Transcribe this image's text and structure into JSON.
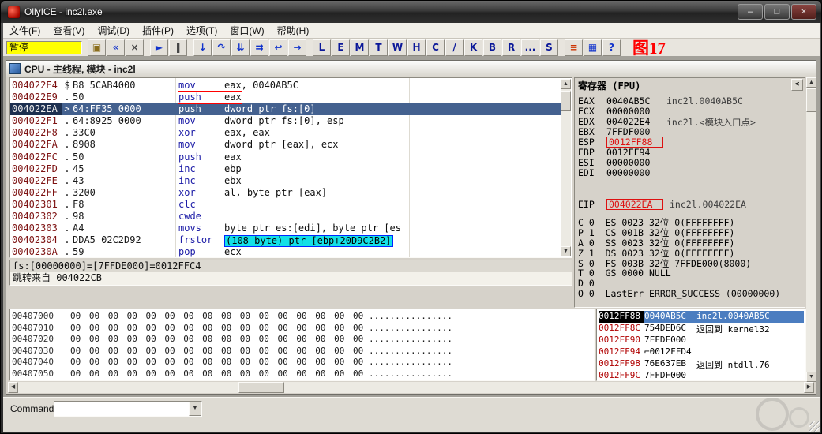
{
  "window": {
    "title": "OllyICE - inc2l.exe",
    "controls": [
      {
        "name": "minimize-button",
        "glyph": "–"
      },
      {
        "name": "maximize-button",
        "glyph": "□"
      },
      {
        "name": "close-button",
        "glyph": "×"
      }
    ]
  },
  "menu": {
    "items": [
      {
        "key": "file",
        "label": "文件(F)"
      },
      {
        "key": "view",
        "label": "查看(V)"
      },
      {
        "key": "debug",
        "label": "调试(D)"
      },
      {
        "key": "plugins",
        "label": "插件(P)"
      },
      {
        "key": "options",
        "label": "选项(T)"
      },
      {
        "key": "window",
        "label": "窗口(W)"
      },
      {
        "key": "help",
        "label": "帮助(H)"
      }
    ]
  },
  "toolbar": {
    "status": "暂停",
    "figure_label": "图17",
    "buttons": [
      {
        "name": "open-file-button",
        "glyph": "▣",
        "color": "#8a6d1a"
      },
      {
        "name": "restart-button",
        "glyph": "«",
        "color": "#1133cc"
      },
      {
        "name": "close-program-button",
        "glyph": "×",
        "color": "#444444"
      },
      {
        "sep": true
      },
      {
        "name": "run-button",
        "glyph": "►",
        "color": "#1133cc"
      },
      {
        "name": "pause-button",
        "glyph": "‖",
        "color": "#444444"
      },
      {
        "sep": true
      },
      {
        "name": "step-into-button",
        "glyph": "↓",
        "color": "#1133cc"
      },
      {
        "name": "step-over-button",
        "glyph": "↷",
        "color": "#1133cc"
      },
      {
        "name": "animate-into-button",
        "glyph": "⇊",
        "color": "#1133cc"
      },
      {
        "name": "animate-over-button",
        "glyph": "⇉",
        "color": "#1133cc"
      },
      {
        "name": "execute-till-return-button",
        "glyph": "↩",
        "color": "#1133cc"
      },
      {
        "name": "go-to-address-button",
        "glyph": "→",
        "color": "#1133cc"
      },
      {
        "sep": true
      },
      {
        "name": "log-window-button",
        "glyph": "L",
        "color": "#0b1899"
      },
      {
        "name": "executables-window-button",
        "glyph": "E",
        "color": "#0b1899"
      },
      {
        "name": "memory-window-button",
        "glyph": "M",
        "color": "#0b1899"
      },
      {
        "name": "threads-window-button",
        "glyph": "T",
        "color": "#0b1899"
      },
      {
        "name": "windows-window-button",
        "glyph": "W",
        "color": "#0b1899"
      },
      {
        "name": "handles-window-button",
        "glyph": "H",
        "color": "#0b1899"
      },
      {
        "name": "cpu-window-button",
        "glyph": "C",
        "color": "#0b1899"
      },
      {
        "name": "patches-window-button",
        "glyph": "/",
        "color": "#0b1899"
      },
      {
        "name": "call-stack-window-button",
        "glyph": "K",
        "color": "#0b1899"
      },
      {
        "name": "breakpoints-window-button",
        "glyph": "B",
        "color": "#0b1899"
      },
      {
        "name": "references-window-button",
        "glyph": "R",
        "color": "#0b1899"
      },
      {
        "name": "run-trace-window-button",
        "glyph": "...",
        "color": "#0b1899"
      },
      {
        "name": "source-window-button",
        "glyph": "S",
        "color": "#0b1899"
      },
      {
        "sep": true
      },
      {
        "name": "options-button",
        "glyph": "≡",
        "color": "#cc3300"
      },
      {
        "name": "appearance-button",
        "glyph": "▦",
        "color": "#1133cc"
      },
      {
        "name": "help-button",
        "glyph": "?",
        "color": "#1133cc"
      }
    ]
  },
  "cpu": {
    "title": "CPU - 主线程, 模块 - inc2l",
    "disasm": {
      "rows": [
        {
          "addr": "004022E4",
          "pre": "$",
          "bytes": "B8 5CAB4000",
          "mn": "mov",
          "op": "eax, 0040AB5C"
        },
        {
          "addr": "004022E9",
          "pre": ".",
          "bytes": "50",
          "mn": "push",
          "op": "eax",
          "redbox": true
        },
        {
          "addr": "004022EA",
          "pre": ">",
          "bytes": "64:FF35 0000",
          "mn": "push",
          "op": "dword ptr fs:[0]",
          "sel": true
        },
        {
          "addr": "004022F1",
          "pre": ".",
          "bytes": "64:8925 0000",
          "mn": "mov",
          "op": "dword ptr fs:[0], esp"
        },
        {
          "addr": "004022F8",
          "pre": ".",
          "bytes": "33C0",
          "mn": "xor",
          "op": "eax, eax"
        },
        {
          "addr": "004022FA",
          "pre": ".",
          "bytes": "8908",
          "mn": "mov",
          "op": "dword ptr [eax], ecx"
        },
        {
          "addr": "004022FC",
          "pre": ".",
          "bytes": "50",
          "mn": "push",
          "op": "eax"
        },
        {
          "addr": "004022FD",
          "pre": ".",
          "bytes": "45",
          "mn": "inc",
          "op": "ebp"
        },
        {
          "addr": "004022FE",
          "pre": ".",
          "bytes": "43",
          "mn": "inc",
          "op": "ebx"
        },
        {
          "addr": "004022FF",
          "pre": ".",
          "bytes": "3200",
          "mn": "xor",
          "op": "al, byte ptr [eax]"
        },
        {
          "addr": "00402301",
          "pre": ".",
          "bytes": "F8",
          "mn": "clc",
          "op": ""
        },
        {
          "addr": "00402302",
          "pre": ".",
          "bytes": "98",
          "mn": "cwde",
          "op": ""
        },
        {
          "addr": "00402303",
          "pre": ".",
          "bytes": "A4",
          "mn": "movs",
          "op": "byte ptr es:[edi], byte ptr [es"
        },
        {
          "addr": "00402304",
          "pre": ".",
          "bytes": "DDA5 02C2D92",
          "mn": "frstor",
          "op": "(108-byte) ptr [ebp+20D9C2B2]",
          "cyan": true
        },
        {
          "addr": "0040230A",
          "pre": ".",
          "bytes": "59",
          "mn": "pop",
          "op": "ecx"
        }
      ]
    },
    "info": {
      "lines": [
        "fs:[00000000]=[7FFDE000]=0012FFC4",
        "跳转来自 004022CB"
      ]
    },
    "registers": {
      "title": "寄存器 (FPU)",
      "collapse": "<",
      "gpr": [
        {
          "name": "EAX",
          "value": "0040AB5C",
          "extra": "inc2l.0040AB5C"
        },
        {
          "name": "ECX",
          "value": "00000000"
        },
        {
          "name": "EDX",
          "value": "004022E4",
          "extra": "inc2l.<模块入口点>"
        },
        {
          "name": "EBX",
          "value": "7FFDF000"
        },
        {
          "name": "ESP",
          "value": "0012FF88",
          "boxed": true
        },
        {
          "name": "EBP",
          "value": "0012FF94"
        },
        {
          "name": "ESI",
          "value": "00000000"
        },
        {
          "name": "EDI",
          "value": "00000000"
        }
      ],
      "eip": {
        "name": "EIP",
        "value": "004022EA",
        "extra": "inc2l.004022EA",
        "boxed": true
      },
      "flags": [
        "C 0  ES 0023 32位 0(FFFFFFFF)",
        "P 1  CS 001B 32位 0(FFFFFFFF)",
        "A 0  SS 0023 32位 0(FFFFFFFF)",
        "Z 1  DS 0023 32位 0(FFFFFFFF)",
        "S 0  FS 003B 32位 7FFDE000(8000)",
        "T 0  GS 0000 NULL",
        "D 0",
        "O 0  LastErr ERROR_SUCCESS (00000000)"
      ]
    },
    "dump": {
      "rows": [
        {
          "addr": "00407000",
          "hex": "00 00 00 00 00 00 00 00 00 00 00 00 00 00 00 00",
          "ascii": "................"
        },
        {
          "addr": "00407010",
          "hex": "00 00 00 00 00 00 00 00 00 00 00 00 00 00 00 00",
          "ascii": "................"
        },
        {
          "addr": "00407020",
          "hex": "00 00 00 00 00 00 00 00 00 00 00 00 00 00 00 00",
          "ascii": "................"
        },
        {
          "addr": "00407030",
          "hex": "00 00 00 00 00 00 00 00 00 00 00 00 00 00 00 00",
          "ascii": "................"
        },
        {
          "addr": "00407040",
          "hex": "00 00 00 00 00 00 00 00 00 00 00 00 00 00 00 00",
          "ascii": "................"
        },
        {
          "addr": "00407050",
          "hex": "00 00 00 00 00 00 00 00 00 00 00 00 00 00 00 00",
          "ascii": "................"
        }
      ]
    },
    "stack": {
      "rows": [
        {
          "addr": "0012FF88",
          "value": "0040AB5C",
          "comment": "inc2l.0040AB5C",
          "selected": true
        },
        {
          "addr": "0012FF8C",
          "value": "754DED6C",
          "comment": "返回到 kernel32"
        },
        {
          "addr": "0012FF90",
          "value": "7FFDF000",
          "comment": ""
        },
        {
          "addr": "0012FF94",
          "value": "0012FFD4",
          "comment": "",
          "marker": "⌐"
        },
        {
          "addr": "0012FF98",
          "value": "76E637EB",
          "comment": "返回到 ntdll.76"
        },
        {
          "addr": "0012FF9C",
          "value": "7FFDF000",
          "comment": ""
        }
      ]
    }
  },
  "command_bar": {
    "label": "Command"
  },
  "colors": {
    "status_bg": "#ffff00",
    "alert_red": "#ff0000",
    "selection_blue": "#44618f",
    "highlight_cyan": "#14e0e6",
    "stack_selection": "#4b7dc0",
    "register_alert": "#dd1111"
  }
}
